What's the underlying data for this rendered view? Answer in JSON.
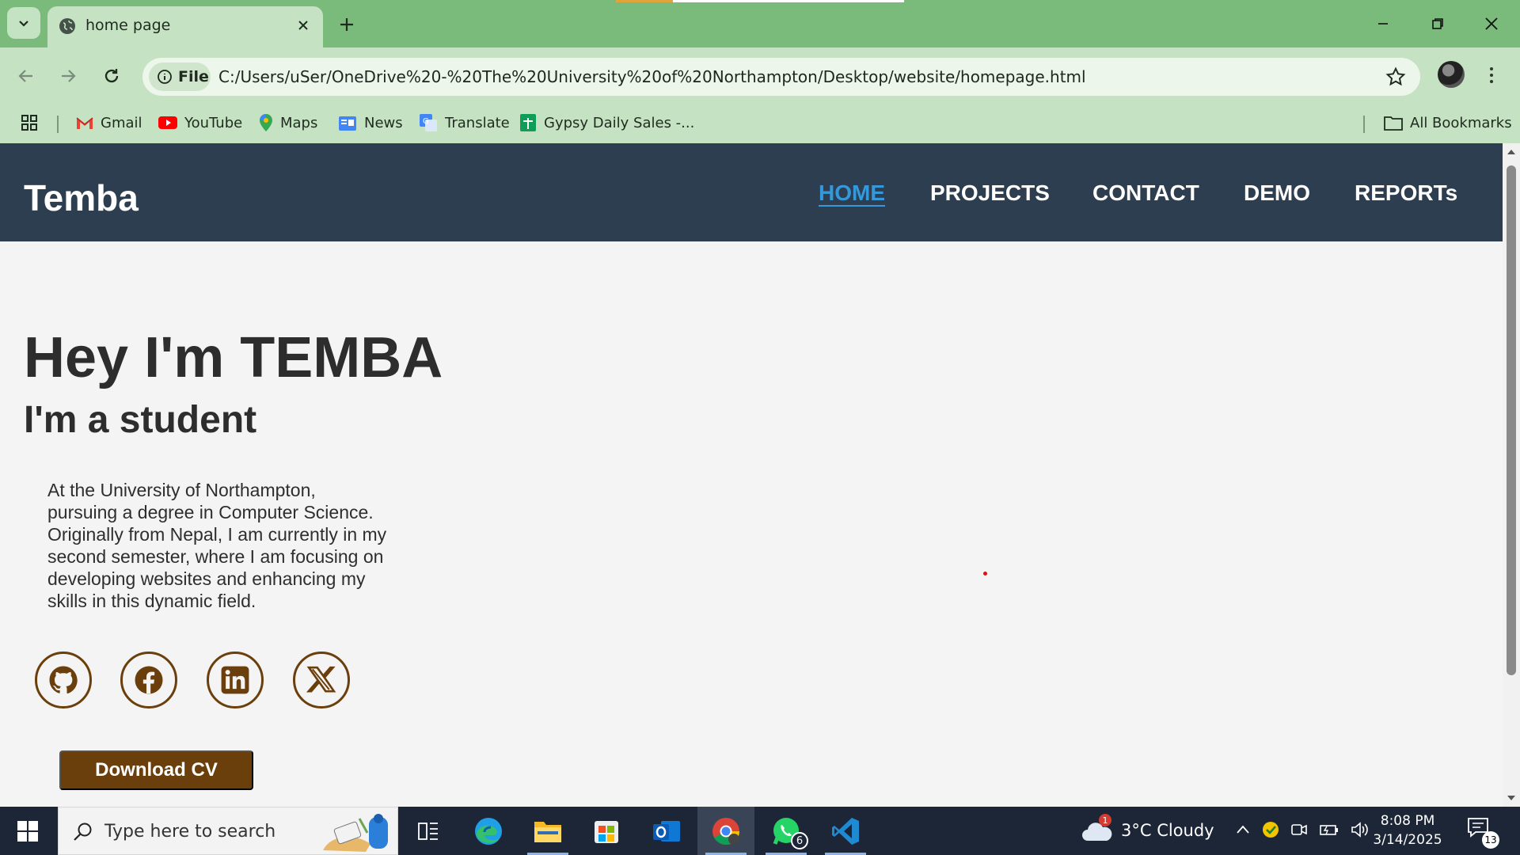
{
  "browser": {
    "tab_title": "home page",
    "url_chip": "File",
    "url": "C:/Users/uSer/OneDrive%20-%20The%20University%20of%20Northampton/Desktop/website/homepage.html",
    "bookmarks": [
      {
        "label": "Gmail",
        "icon": "gmail-icon"
      },
      {
        "label": "YouTube",
        "icon": "youtube-icon"
      },
      {
        "label": "Maps",
        "icon": "maps-icon"
      },
      {
        "label": "News",
        "icon": "news-icon"
      },
      {
        "label": "Translate",
        "icon": "translate-icon"
      },
      {
        "label": "Gypsy Daily Sales -...",
        "icon": "sheets-icon"
      }
    ],
    "all_bookmarks": "All Bookmarks",
    "colors": {
      "frame": "#7aba7a",
      "toolbar": "#c5e3c3"
    }
  },
  "site": {
    "brand": "Temba",
    "nav": [
      "HOME",
      "PROJECTS",
      "CONTACT",
      "DEMO",
      "REPORTs"
    ],
    "active_nav": "HOME",
    "hero_title": "Hey I'm TEMBA",
    "hero_subtitle": "I'm a student",
    "bio": "At the University of Northampton, pursuing a degree in Computer Science. Originally from Nepal, I am currently in my second semester, where I am focusing on developing websites and enhancing my skills in this dynamic field.",
    "socials": [
      "github-icon",
      "facebook-icon",
      "linkedin-icon",
      "x-icon"
    ],
    "cv_button": "Download CV",
    "colors": {
      "header": "#2c3e50",
      "accent": "#3498db",
      "brown": "#6b3f0c"
    }
  },
  "taskbar": {
    "search_placeholder": "Type here to search",
    "weather": "3°C  Cloudy",
    "weather_badge": "1",
    "whatsapp_badge": "6",
    "time": "8:08 PM",
    "date": "3/14/2025",
    "notifications": "13"
  }
}
